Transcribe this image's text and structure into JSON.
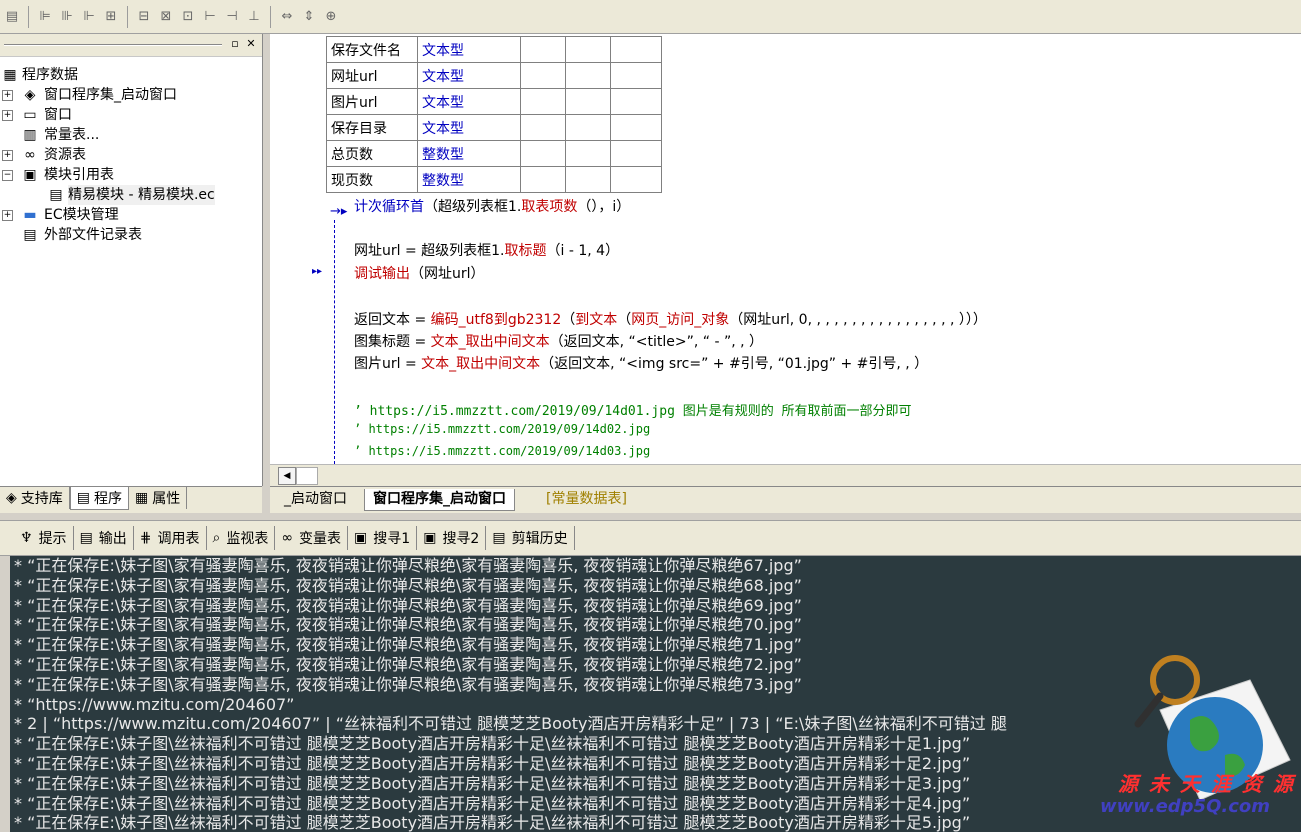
{
  "toolbar": {
    "icons": [
      "window-icon",
      "align-left-icon",
      "align-center-icon",
      "align-right-icon",
      "distribute-icon",
      "group-icon",
      "ungroup-icon",
      "grid-icon",
      "size-icon",
      "spacing-icon",
      "text-icon",
      "width-icon",
      "height-icon",
      "center-icon"
    ]
  },
  "left_panel": {
    "tree": [
      {
        "label": "程序数据",
        "icon": "program-data-icon"
      },
      {
        "label": "窗口程序集_启动窗口",
        "icon": "assembly-icon"
      },
      {
        "label": "窗口",
        "icon": "window-icon"
      },
      {
        "label": "常量表...",
        "icon": "constants-icon"
      },
      {
        "label": "资源表",
        "icon": "resource-icon"
      },
      {
        "label": "模块引用表",
        "icon": "module-ref-icon"
      },
      {
        "label": "精易模块 - 精易模块.ec",
        "icon": "module-file-icon"
      },
      {
        "label": "EC模块管理",
        "icon": "ec-folder-icon"
      },
      {
        "label": "外部文件记录表",
        "icon": "external-file-icon"
      }
    ],
    "tabs": [
      {
        "label": "支持库",
        "icon": "library-icon"
      },
      {
        "label": "程序",
        "icon": "program-icon"
      },
      {
        "label": "属性",
        "icon": "properties-icon"
      }
    ]
  },
  "variables": [
    {
      "name": "保存文件名",
      "type": "文本型"
    },
    {
      "name": "网址url",
      "type": "文本型"
    },
    {
      "name": "图片url",
      "type": "文本型"
    },
    {
      "name": "保存目录",
      "type": "文本型"
    },
    {
      "name": "总页数",
      "type": "整数型"
    },
    {
      "name": "现页数",
      "type": "整数型"
    }
  ],
  "code": {
    "loop_kw": "计次循环首",
    "loop_args1": "（超级列表框1.",
    "loop_fn": "取表项数",
    "loop_args2": "（），i）",
    "l1a": "网址url = 超级列表框1.",
    "l1fn": "取标题",
    "l1b": "（i - 1, 4）",
    "l2fn": "调试输出",
    "l2b": "（网址url）",
    "l3a": "返回文本 = ",
    "l3fn": "编码_utf8到gb2312",
    "l3b": "（",
    "l3fn2": "到文本",
    "l3c": "（",
    "l3fn3": "网页_访问_对象",
    "l3d": "（网址url, 0, , , , , , , , , , , , , , , , , ）））",
    "l4a": "图集标题 = ",
    "l4fn": "文本_取出中间文本",
    "l4b": "（返回文本, “<title>”, “ - ”, , ）",
    "l5a": "图片url = ",
    "l5fn": "文本_取出中间文本",
    "l5b": "（返回文本, “<img src=” + #引号, “01.jpg” + #引号, , ）",
    "c1": "’ https://i5.mmzztt.com/2019/09/14d01.jpg 图片是有规则的 所有取前面一部分即可",
    "c2": "’ https://i5.mmzztt.com/2019/09/14d02.jpg",
    "c3": "’ https://i5.mmzztt.com/2019/09/14d03.jpg"
  },
  "file_tabs": [
    "_启动窗口",
    "窗口程序集_启动窗口",
    "[常量数据表]"
  ],
  "output_tabs": [
    {
      "label": "提示",
      "icon": "hint-icon"
    },
    {
      "label": "输出",
      "icon": "output-icon"
    },
    {
      "label": "调用表",
      "icon": "call-table-icon"
    },
    {
      "label": "监视表",
      "icon": "watch-icon"
    },
    {
      "label": "变量表",
      "icon": "variables-icon"
    },
    {
      "label": "搜寻1",
      "icon": "search1-icon"
    },
    {
      "label": "搜寻2",
      "icon": "search2-icon"
    },
    {
      "label": "剪辑历史",
      "icon": "clip-history-icon"
    }
  ],
  "output_lines": [
    "* “正在保存E:\\妹子图\\家有骚妻陶喜乐, 夜夜销魂让你弹尽粮绝\\家有骚妻陶喜乐, 夜夜销魂让你弹尽粮绝67.jpg”",
    "* “正在保存E:\\妹子图\\家有骚妻陶喜乐, 夜夜销魂让你弹尽粮绝\\家有骚妻陶喜乐, 夜夜销魂让你弹尽粮绝68.jpg”",
    "* “正在保存E:\\妹子图\\家有骚妻陶喜乐, 夜夜销魂让你弹尽粮绝\\家有骚妻陶喜乐, 夜夜销魂让你弹尽粮绝69.jpg”",
    "* “正在保存E:\\妹子图\\家有骚妻陶喜乐, 夜夜销魂让你弹尽粮绝\\家有骚妻陶喜乐, 夜夜销魂让你弹尽粮绝70.jpg”",
    "* “正在保存E:\\妹子图\\家有骚妻陶喜乐, 夜夜销魂让你弹尽粮绝\\家有骚妻陶喜乐, 夜夜销魂让你弹尽粮绝71.jpg”",
    "* “正在保存E:\\妹子图\\家有骚妻陶喜乐, 夜夜销魂让你弹尽粮绝\\家有骚妻陶喜乐, 夜夜销魂让你弹尽粮绝72.jpg”",
    "* “正在保存E:\\妹子图\\家有骚妻陶喜乐, 夜夜销魂让你弹尽粮绝\\家有骚妻陶喜乐, 夜夜销魂让你弹尽粮绝73.jpg”",
    "* “https://www.mzitu.com/204607”",
    "* 2 | “https://www.mzitu.com/204607” | “丝袜福利不可错过 腿模芝芝Booty酒店开房精彩十足” | 73 | “E:\\妹子图\\丝袜福利不可错过 腿",
    "* “正在保存E:\\妹子图\\丝袜福利不可错过 腿模芝芝Booty酒店开房精彩十足\\丝袜福利不可错过 腿模芝芝Booty酒店开房精彩十足1.jpg”",
    "* “正在保存E:\\妹子图\\丝袜福利不可错过 腿模芝芝Booty酒店开房精彩十足\\丝袜福利不可错过 腿模芝芝Booty酒店开房精彩十足2.jpg”",
    "* “正在保存E:\\妹子图\\丝袜福利不可错过 腿模芝芝Booty酒店开房精彩十足\\丝袜福利不可错过 腿模芝芝Booty酒店开房精彩十足3.jpg”",
    "* “正在保存E:\\妹子图\\丝袜福利不可错过 腿模芝芝Booty酒店开房精彩十足\\丝袜福利不可错过 腿模芝芝Booty酒店开房精彩十足4.jpg”",
    "* “正在保存E:\\妹子图\\丝袜福利不可错过 腿模芝芝Booty酒店开房精彩十足\\丝袜福利不可错过 腿模芝芝Booty酒店开房精彩十足5.jpg”"
  ],
  "watermark": {
    "line1": "源 未 天 涯 资 源 网",
    "line2": "www.edp5Q.com"
  }
}
